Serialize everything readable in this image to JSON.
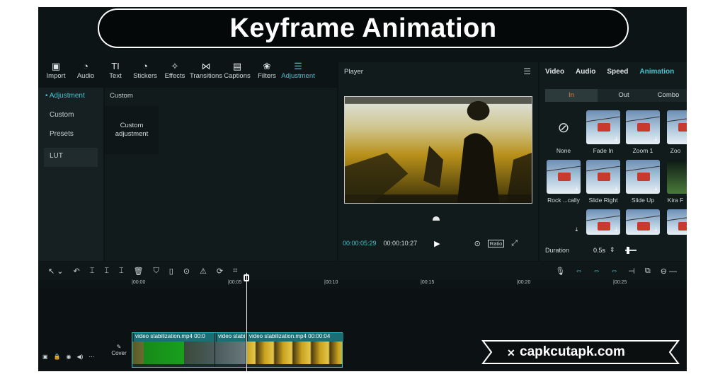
{
  "title": "Keyframe Animation",
  "toolbar": [
    {
      "label": "Import",
      "icon": "import-icon",
      "glyph": "▣"
    },
    {
      "label": "Audio",
      "icon": "audio-icon",
      "glyph": "◔"
    },
    {
      "label": "Text",
      "icon": "text-icon",
      "glyph": "TI"
    },
    {
      "label": "Stickers",
      "icon": "stickers-icon",
      "glyph": "◔"
    },
    {
      "label": "Effects",
      "icon": "effects-icon",
      "glyph": "✧"
    },
    {
      "label": "Transitions",
      "icon": "transitions-icon",
      "glyph": "⋈"
    },
    {
      "label": "Captions",
      "icon": "captions-icon",
      "glyph": "▤"
    },
    {
      "label": "Filters",
      "icon": "filters-icon",
      "glyph": "❀"
    },
    {
      "label": "Adjustment",
      "icon": "adjustment-icon",
      "glyph": "☰"
    }
  ],
  "sidebar": {
    "items": [
      "• Adjustment",
      "Custom",
      "Presets",
      "LUT"
    ]
  },
  "mid": {
    "section": "Custom",
    "card": "Custom adjustment"
  },
  "player": {
    "title": "Player",
    "current_time": "00:00:05:29",
    "total_time": "00:00:10:27",
    "ratio": "Ratio"
  },
  "right": {
    "tabs": [
      "Video",
      "Audio",
      "Speed",
      "Animation"
    ],
    "subtabs": [
      "In",
      "Out",
      "Combo"
    ],
    "animations": [
      "None",
      "Fade In",
      "Zoom 1",
      "Zoo",
      "Rock ...cally",
      "Slide Right",
      "Slide Up",
      "Kira F"
    ],
    "duration_label": "Duration",
    "duration_value": "0.5s"
  },
  "ruler": [
    "|00:00",
    "|00:05",
    "|00:10",
    "|00:15",
    "|00:20",
    "|00:25"
  ],
  "timeline": {
    "clips": [
      "video stabilization.mp4  00:0",
      "video stabi",
      "video stabilization.mp4  00:00:04"
    ],
    "cover_label": "Cover"
  },
  "watermark": "capkcutapk.com",
  "colors": {
    "accent": "#3fc7cf",
    "subtab_active": "#e07b3c",
    "background": "#0d1415"
  }
}
